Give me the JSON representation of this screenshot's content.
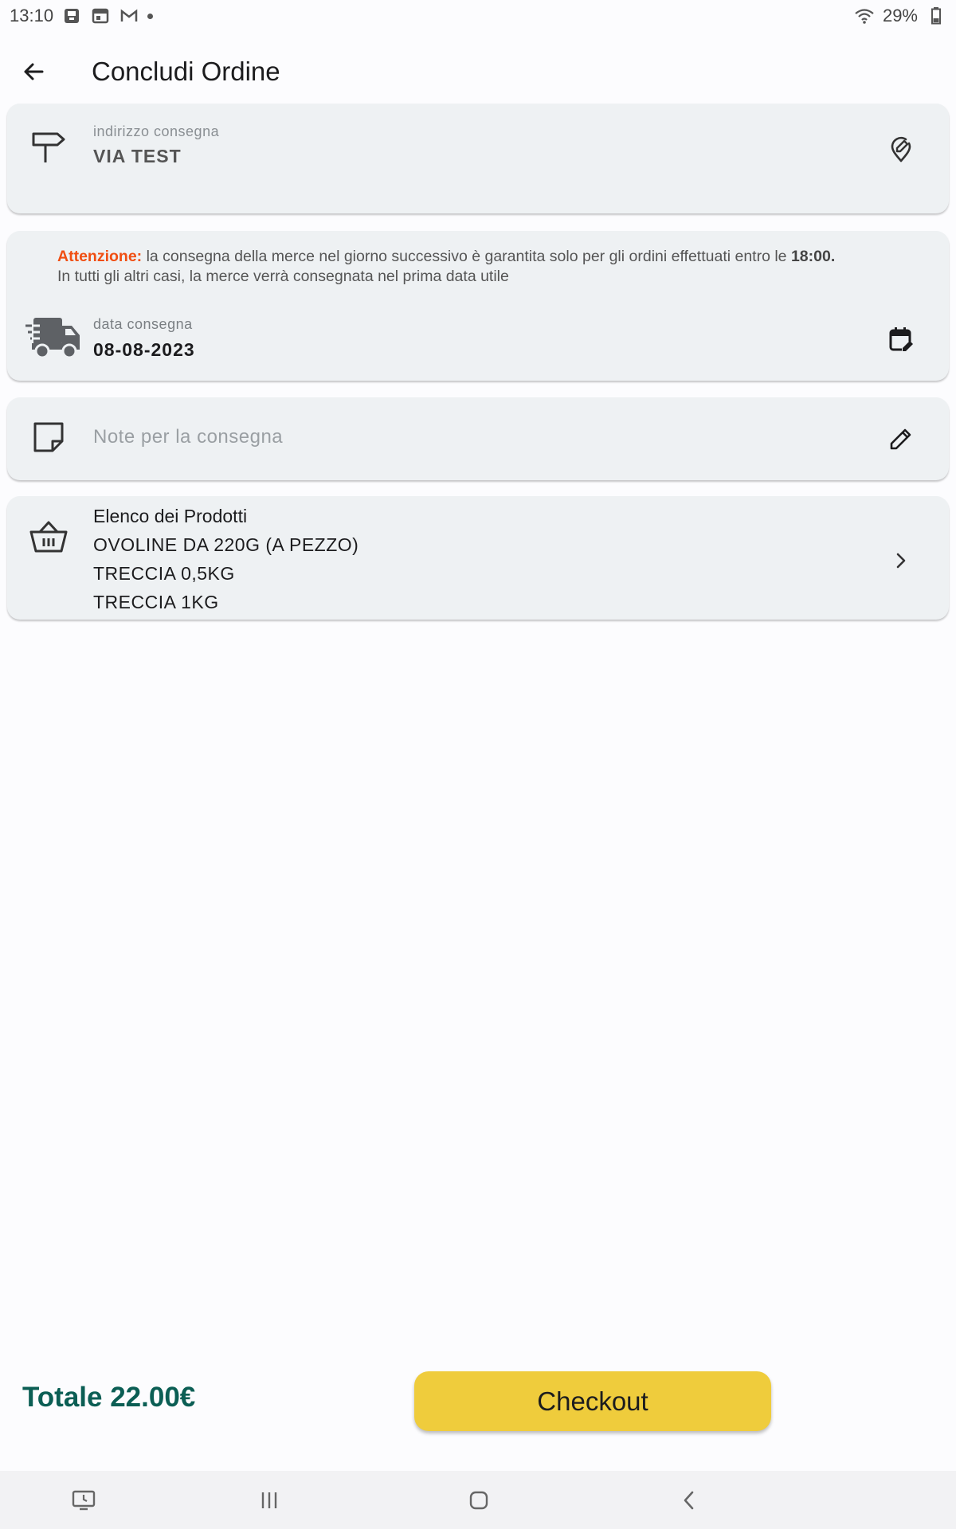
{
  "status_bar": {
    "time": "13:10",
    "battery": "29%",
    "icons": [
      "notification-icon",
      "calendar-icon",
      "gmail-icon",
      "dot-icon",
      "wifi-icon",
      "battery-icon"
    ]
  },
  "header": {
    "title": "Concludi Ordine",
    "back_icon": "arrow-left-icon"
  },
  "address_card": {
    "label": "indirizzo consegna",
    "value": "VIA TEST",
    "icon": "signpost-icon",
    "action_icon": "edit-location-icon"
  },
  "delivery_card": {
    "warning_label": "Attenzione:",
    "warning_text_1": "la consegna della merce  nel giorno successivo è garantita solo per gli ordini effettuati entro le",
    "warning_time": "18:00.",
    "warning_text_2": "In tutti gli altri casi, la merce verrà consegnata nel prima data utile",
    "label": "data consegna",
    "value": "08-08-2023",
    "icon": "delivery-truck-icon",
    "action_icon": "edit-calendar-icon"
  },
  "notes_card": {
    "placeholder": "Note per la consegna",
    "icon": "sticky-note-icon",
    "action_icon": "pencil-icon"
  },
  "products_card": {
    "title": "Elenco dei Prodotti",
    "items": [
      "OVOLINE DA 220G (A PEZZO)",
      "TRECCIA 0,5KG",
      "TRECCIA 1KG"
    ],
    "icon": "basket-icon",
    "action_icon": "chevron-right-icon"
  },
  "footer": {
    "total": "Totale 22.00€",
    "checkout_label": "Checkout"
  },
  "colors": {
    "background": "#fcfcfe",
    "card": "#eef1f3",
    "accent_button": "#efcc3c",
    "total_text": "#0b5e54",
    "warning": "#f04e12"
  },
  "nav_bar": {
    "icons": [
      "screen-icon",
      "recents-icon",
      "home-icon",
      "back-nav-icon"
    ]
  }
}
